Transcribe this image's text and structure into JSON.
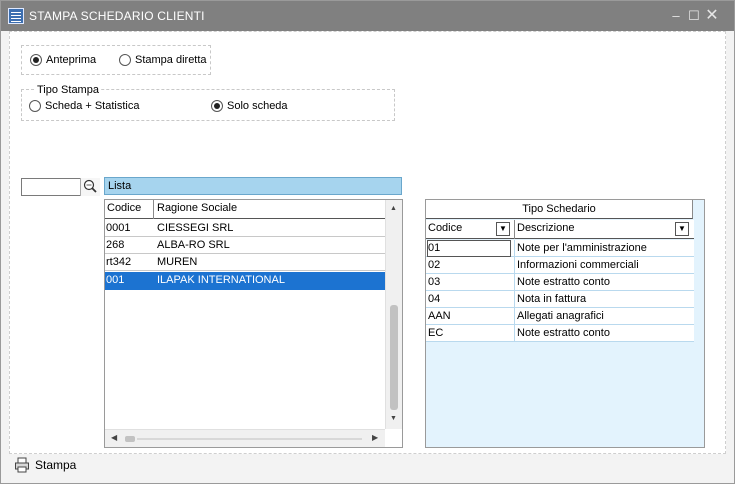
{
  "window": {
    "title": "STAMPA SCHEDARIO CLIENTI"
  },
  "output_mode": {
    "anteprima": "Anteprima",
    "stampa_diretta": "Stampa diretta",
    "selected": "Anteprima"
  },
  "tipo_stampa": {
    "legend": "Tipo Stampa",
    "scheda_statistica": "Scheda + Statistica",
    "solo_scheda": "Solo scheda",
    "selected": "Solo scheda"
  },
  "search": {
    "value": "",
    "icon": "search-icon"
  },
  "lista": {
    "header": "Lista",
    "columns": [
      "Codice",
      "Ragione Sociale"
    ],
    "rows": [
      [
        "0001",
        "CIESSEGI SRL"
      ],
      [
        "268",
        "ALBA-RO SRL"
      ],
      [
        "rt342",
        "MUREN"
      ],
      [
        "001",
        "ILAPAK INTERNATIONAL"
      ]
    ],
    "selected_row": 3
  },
  "tipo_schedario": {
    "caption": "Tipo Schedario",
    "columns": [
      "Codice",
      "Descrizione"
    ],
    "rows": [
      [
        "01",
        "Note per l'amministrazione"
      ],
      [
        "02",
        "Informazioni commerciali"
      ],
      [
        "03",
        "Note estratto conto"
      ],
      [
        "04",
        "Nota in fattura"
      ],
      [
        "AAN",
        "Allegati anagrafici"
      ],
      [
        "EC",
        "Note estratto conto"
      ]
    ]
  },
  "statusbar": {
    "stampa_label": "Stampa"
  },
  "colors": {
    "selection": "#1c73d1",
    "lista_header": "#a6d4ee",
    "grid_bg": "#e3f3fd"
  }
}
